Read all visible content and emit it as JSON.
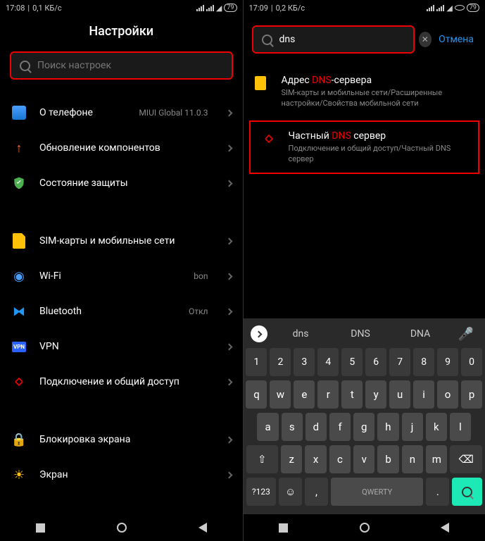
{
  "left": {
    "status": {
      "time": "17:08",
      "speed": "0,1 КБ/с",
      "battery": "79"
    },
    "title": "Настройки",
    "search_placeholder": "Поиск настроек",
    "items": [
      {
        "icon": "phone",
        "label": "О телефоне",
        "value": "MIUI Global 11.0.3"
      },
      {
        "icon": "update",
        "label": "Обновление компонентов",
        "value": ""
      },
      {
        "icon": "shield",
        "label": "Состояние защиты",
        "value": ""
      },
      {
        "gap": true
      },
      {
        "icon": "sim",
        "label": "SIM-карты и мобильные сети",
        "value": ""
      },
      {
        "icon": "wifi",
        "label": "Wi-Fi",
        "value": "bon"
      },
      {
        "icon": "bt",
        "label": "Bluetooth",
        "value": "Откл"
      },
      {
        "icon": "vpn",
        "label": "VPN",
        "value": ""
      },
      {
        "icon": "share",
        "label": "Подключение и общий доступ",
        "value": ""
      },
      {
        "gap": true
      },
      {
        "icon": "lock",
        "label": "Блокировка экрана",
        "value": ""
      },
      {
        "icon": "screen",
        "label": "Экран",
        "value": ""
      }
    ]
  },
  "right": {
    "status": {
      "time": "17:09",
      "speed": "0,2 КБ/с",
      "battery": "79"
    },
    "search_value": "dns",
    "cancel": "Отмена",
    "results": [
      {
        "icon": "doc",
        "title_pre": "Адрес ",
        "title_match": "DNS",
        "title_post": "-сервера",
        "sub": "SIM-карты и мобильные сети/Расширенные настройки/Свойства мобильной сети",
        "hl": false
      },
      {
        "icon": "share",
        "title_pre": "Частный ",
        "title_match": "DNS",
        "title_post": " сервер",
        "sub": "Подключение и общий доступ/Частный DNS сервер",
        "hl": true
      }
    ],
    "kb": {
      "suggestions": [
        "dns",
        "DNS",
        "DNA"
      ],
      "row1": [
        "1",
        "2",
        "3",
        "4",
        "5",
        "6",
        "7",
        "8",
        "9",
        "0"
      ],
      "row2": [
        "q",
        "w",
        "e",
        "r",
        "t",
        "y",
        "u",
        "i",
        "o",
        "p"
      ],
      "row3": [
        "a",
        "s",
        "d",
        "f",
        "g",
        "h",
        "j",
        "k",
        "l"
      ],
      "row4": [
        "z",
        "x",
        "c",
        "v",
        "b",
        "n",
        "m"
      ],
      "num_key": "?123",
      "space": "QWERTY"
    }
  }
}
